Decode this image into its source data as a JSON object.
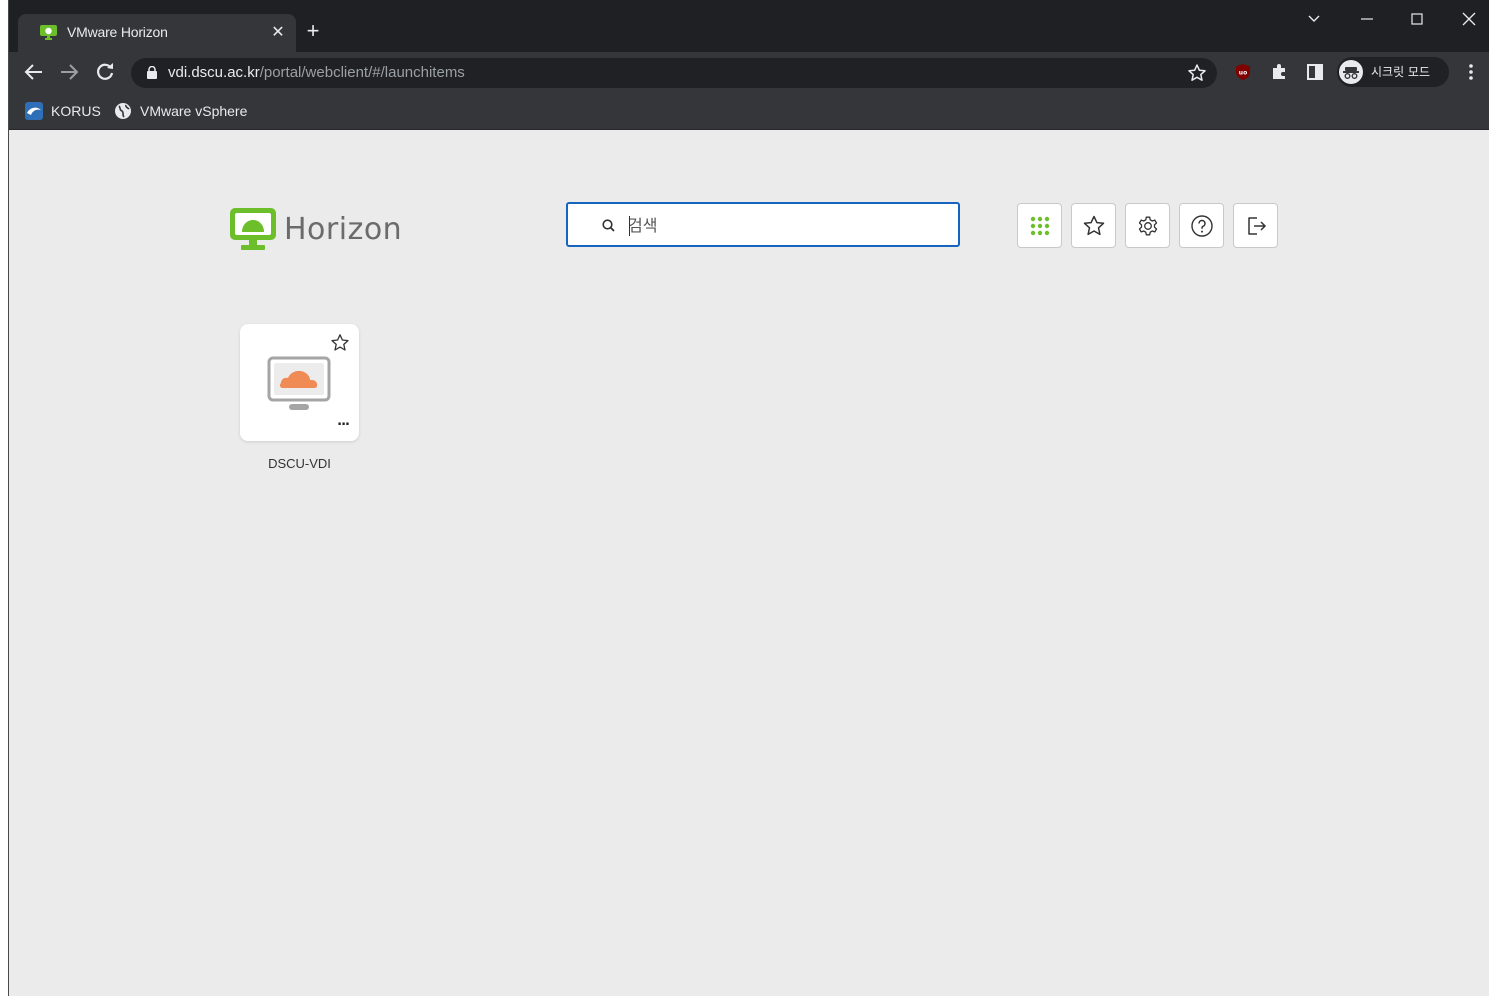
{
  "browser": {
    "tab_title": "VMware Horizon",
    "url_host": "vdi.dscu.ac.kr",
    "url_path": "/portal/webclient/#/launchitems",
    "incognito_label": "시크릿 모드",
    "bookmarks": [
      {
        "label": "KORUS",
        "icon": "korus-icon"
      },
      {
        "label": "VMware vSphere",
        "icon": "globe-icon"
      }
    ]
  },
  "horizon": {
    "brand": "Horizon",
    "search_placeholder": "검색",
    "header_buttons": [
      "apps-grid-icon",
      "favorites-star-icon",
      "settings-gear-icon",
      "help-icon",
      "logout-icon"
    ],
    "items": [
      {
        "label": "DSCU-VDI",
        "icon": "desktop-cloud-icon",
        "more": "..."
      }
    ]
  },
  "colors": {
    "tabstrip": "#1f2023",
    "toolbar": "#35363a",
    "content_bg": "#ebebeb",
    "brand_green": "#6cbf2a",
    "search_border": "#1565c0",
    "cloud_orange": "#f08b55"
  }
}
